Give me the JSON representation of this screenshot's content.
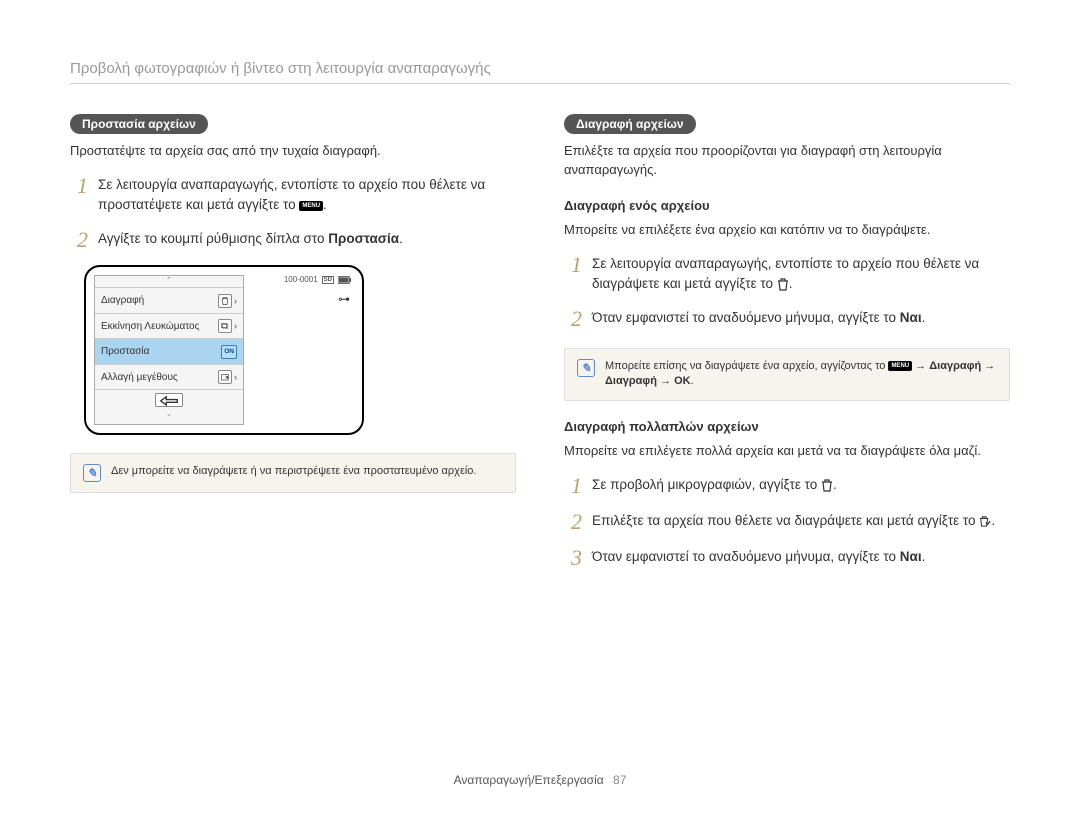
{
  "page_title": "Προβολή φωτογραφιών ή βίντεο στη λειτουργία αναπαραγωγής",
  "footer_section": "Αναπαραγωγή/Επεξεργασία",
  "footer_page": "87",
  "left": {
    "heading": "Προστασία αρχείων",
    "intro": "Προστατέψτε τα αρχεία σας από την τυχαία διαγραφή.",
    "step1_a": "Σε λειτουργία αναπαραγωγής, εντοπίστε το αρχείο που θέλετε να προστατέψετε και μετά αγγίξτε το ",
    "step1_b": ".",
    "step2_a": "Αγγίξτε το κουμπί ρύθμισης δίπλα στο ",
    "step2_b": "Προστασία",
    "step2_c": ".",
    "note": "Δεν μπορείτε να διαγράψετε ή να περιστρέψετε ένα προστατευμένο αρχείο.",
    "device": {
      "file_index": "100-0001",
      "items": {
        "delete": "Διαγραφή",
        "album": "Εκκίνηση Λευκώματος",
        "protect": "Προστασία",
        "resize": "Αλλαγή μεγέθους"
      },
      "on_label": "ON"
    }
  },
  "right": {
    "heading": "Διαγραφή αρχείων",
    "intro": "Επιλέξτε τα αρχεία που προορίζονται για διαγραφή στη λειτουργία αναπαραγωγής.",
    "sub1": "Διαγραφή ενός αρχείου",
    "sub1_intro": "Μπορείτε να επιλέξετε ένα αρχείο και κατόπιν να το διαγράψετε.",
    "s1_step1": "Σε λειτουργία αναπαραγωγής, εντοπίστε το αρχείο που θέλετε να διαγράψετε και μετά αγγίξτε το ",
    "s1_step2_a": "Όταν εμφανιστεί το αναδυόμενο μήνυμα, αγγίξτε το ",
    "s1_step2_b": "Ναι",
    "s1_step2_c": ".",
    "note2_a": "Μπορείτε επίσης να διαγράψετε ένα αρχείο, αγγίζοντας το ",
    "note2_b": " → ",
    "note2_c": "Διαγραφή",
    "note2_d": " → ",
    "note2_e": "Διαγραφή",
    "note2_f": " → ",
    "note2_g": ".",
    "sub2": "Διαγραφή πολλαπλών αρχείων",
    "sub2_intro": "Μπορείτε να επιλέγετε πολλά αρχεία και μετά να τα διαγράψετε όλα μαζί.",
    "s2_step1": "Σε προβολή μικρογραφιών, αγγίξτε το ",
    "s2_step2": "Επιλέξτε τα αρχεία που θέλετε να διαγράψετε και μετά αγγίξτε το ",
    "s2_step3_a": "Όταν εμφανιστεί το αναδυόμενο μήνυμα, αγγίξτε το ",
    "s2_step3_b": "Ναι",
    "s2_step3_c": "."
  },
  "icons": {
    "menu": "MENU"
  }
}
